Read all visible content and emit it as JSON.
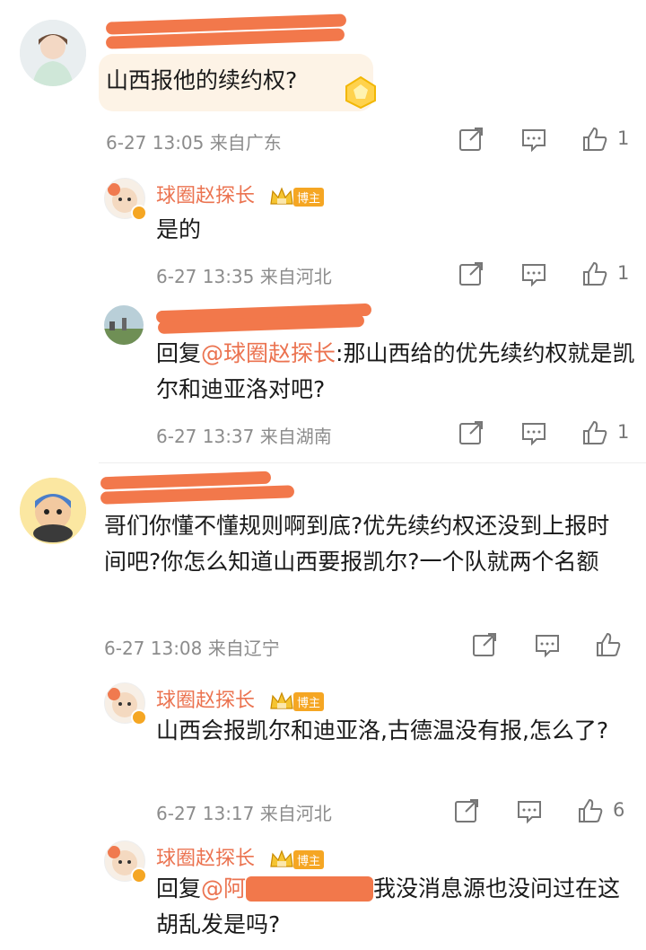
{
  "comments": [
    {
      "text": "山西报他的续约权?",
      "meta": "6-27 13:05 来自广东",
      "likes": "1",
      "replies": [
        {
          "name": "球圈赵探长",
          "badge": "博主",
          "text": "是的",
          "meta": "6-27 13:35 来自河北",
          "likes": "1"
        },
        {
          "prefix": "回复",
          "mention": "@球圈赵探长",
          "text": ":那山西给的优先续约权就是凯尔和迪亚洛对吧?",
          "meta": "6-27 13:37 来自湖南",
          "likes": "1"
        }
      ]
    },
    {
      "text": "哥们你懂不懂规则啊到底?优先续约权还没到上报时间吧?你怎么知道山西要报凯尔?一个队就两个名额",
      "meta": "6-27 13:08 来自辽宁",
      "likes": "",
      "replies": [
        {
          "name": "球圈赵探长",
          "badge": "博主",
          "text": "山西会报凯尔和迪亚洛,古德温没有报,怎么了?",
          "meta": "6-27 13:17 来自河北",
          "likes": "6"
        },
        {
          "name": "球圈赵探长",
          "badge": "博主",
          "prefix": "回复",
          "mention": "@阿",
          "text": "我没消息源也没问过在这胡乱发是吗?"
        }
      ]
    }
  ],
  "icons": [
    "share-icon",
    "comment-icon",
    "like-icon",
    "crown-icon"
  ],
  "colors": {
    "accent": "#eb7350",
    "meta": "#8c8c8c",
    "redaction": "#f2784b",
    "badge": "#f5a623"
  }
}
